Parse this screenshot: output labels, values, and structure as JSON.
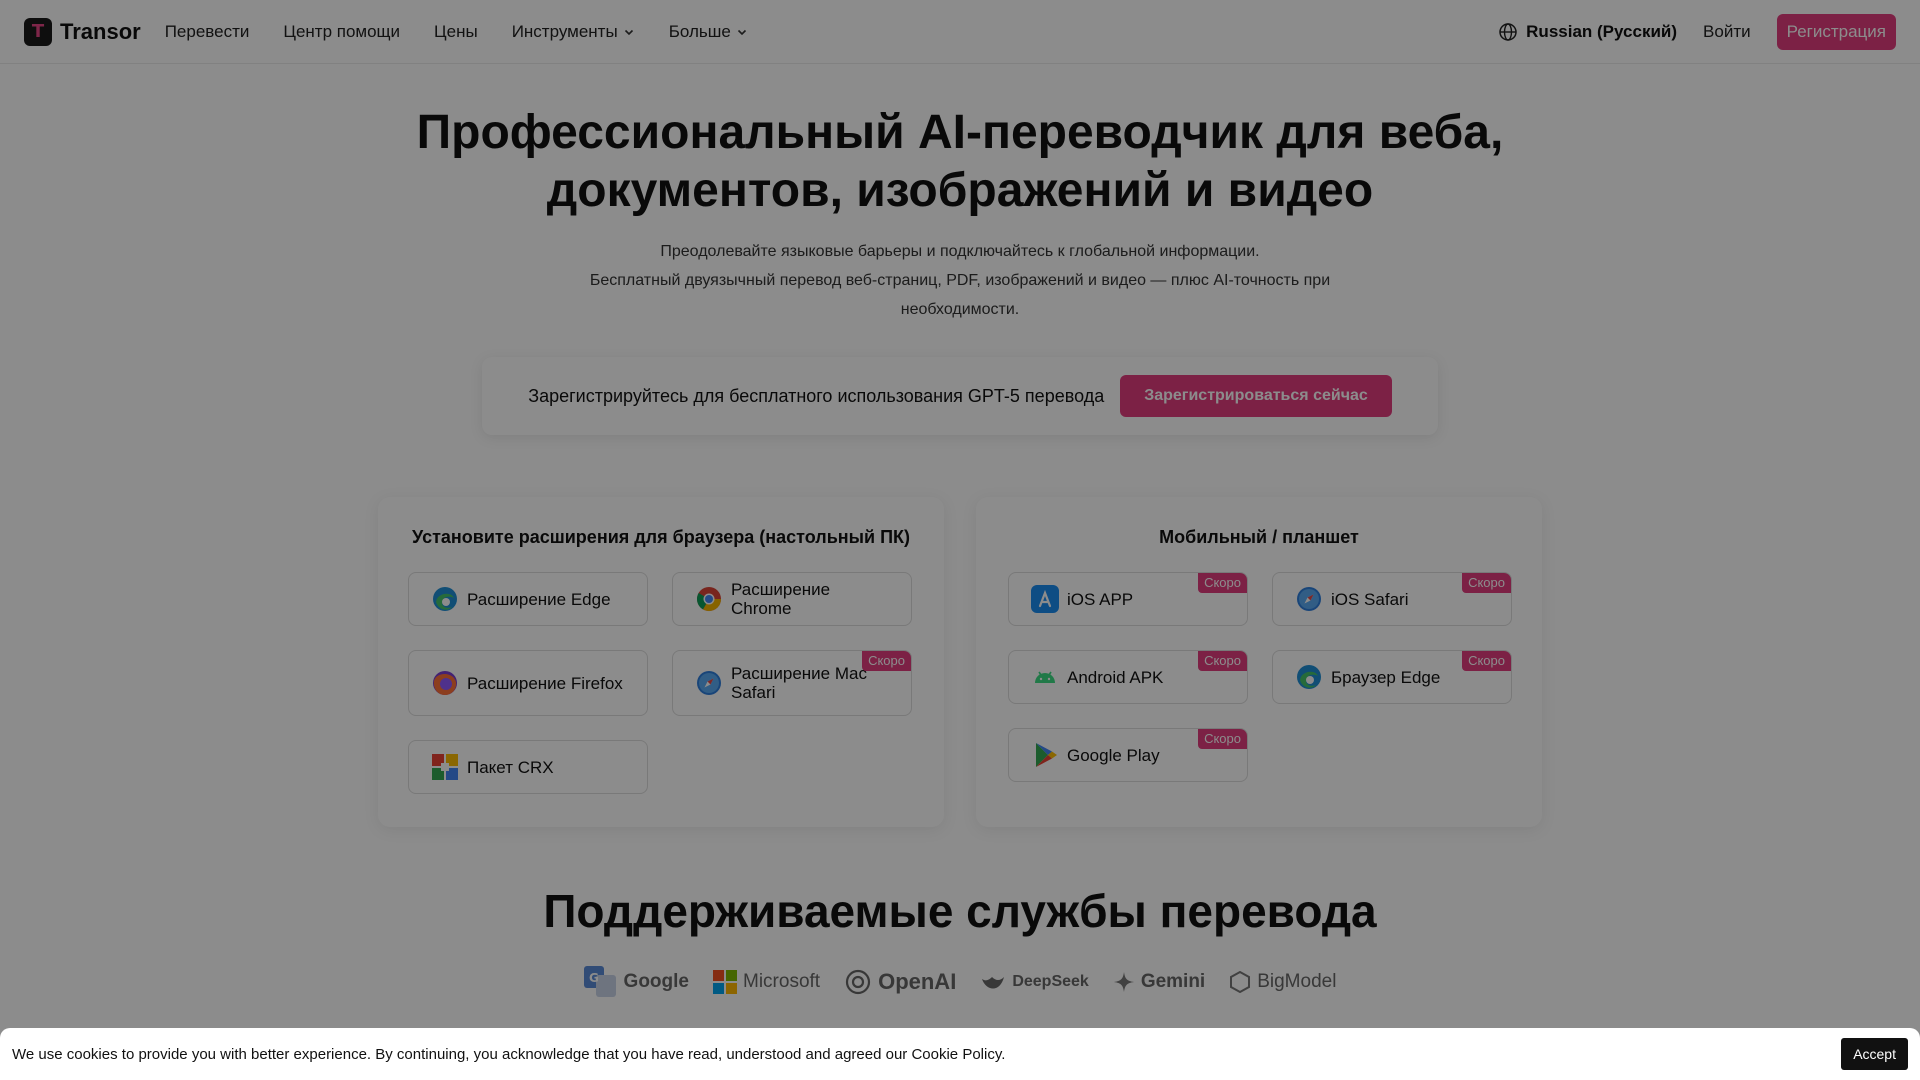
{
  "header": {
    "logo_letter": "T",
    "logo_text": "Transor",
    "nav": [
      {
        "label": "Перевести"
      },
      {
        "label": "Центр помощи"
      },
      {
        "label": "Цены"
      },
      {
        "label": "Инструменты"
      },
      {
        "label": "Больше"
      }
    ],
    "language": "Russian (Русский)",
    "login": "Войти",
    "register": "Регистрация"
  },
  "hero": {
    "title_line1": "Профессиональный AI-переводчик для веба,",
    "title_line2": "документов, изображений и видео",
    "sub_line1": "Преодолевайте языковые барьеры и подключайтесь к глобальной информации.",
    "sub_line2": "Бесплатный двуязычный перевод веб-страниц, PDF, изображений и видео — плюс AI-точность при",
    "sub_line3": "необходимости."
  },
  "promo": {
    "text": "Зарегистрируйтесь для бесплатного использования GPT-5 перевода",
    "button": "Зарегистрироваться сейчас"
  },
  "desktop": {
    "title": "Установите расширения для браузера (настольный ПК)",
    "items": [
      {
        "label": "Расширение Edge",
        "icon": "edge-icon"
      },
      {
        "label": "Расширение Chrome",
        "icon": "chrome-icon"
      },
      {
        "label": "Расширение Firefox",
        "icon": "firefox-icon"
      },
      {
        "label_line1": "Расширение Mac",
        "label_line2": "Safari",
        "icon": "safari-icon",
        "badge": "Скоро"
      },
      {
        "label": "Пакет CRX",
        "icon": "crx-icon"
      }
    ]
  },
  "mobile": {
    "title": "Мобильный / планшет",
    "items": [
      {
        "label": "iOS APP",
        "icon": "app-store-icon",
        "badge": "Скоро"
      },
      {
        "label": "iOS Safari",
        "icon": "safari-icon",
        "badge": "Скоро"
      },
      {
        "label": "Android APK",
        "icon": "android-icon",
        "badge": "Скоро"
      },
      {
        "label": "Браузер Edge",
        "icon": "edge-icon",
        "badge": "Скоро"
      },
      {
        "label": "Google Play",
        "icon": "google-play-icon",
        "badge": "Скоро"
      }
    ]
  },
  "services": {
    "title": "Поддерживаемые службы перевода",
    "items": [
      {
        "label": "Google"
      },
      {
        "label": "Microsoft"
      },
      {
        "label": "OpenAI"
      },
      {
        "label": "DeepSeek"
      },
      {
        "label": "Gemini"
      },
      {
        "label": "BigModel"
      }
    ]
  },
  "cookie": {
    "text": "We use cookies to provide you with better experience. By continuing, you acknowledge that you have read, understood and agreed our Cookie Policy.",
    "accept": "Accept"
  },
  "colors": {
    "accent": "#e23d7e",
    "overlay": "rgba(0,0,0,0.45)"
  }
}
